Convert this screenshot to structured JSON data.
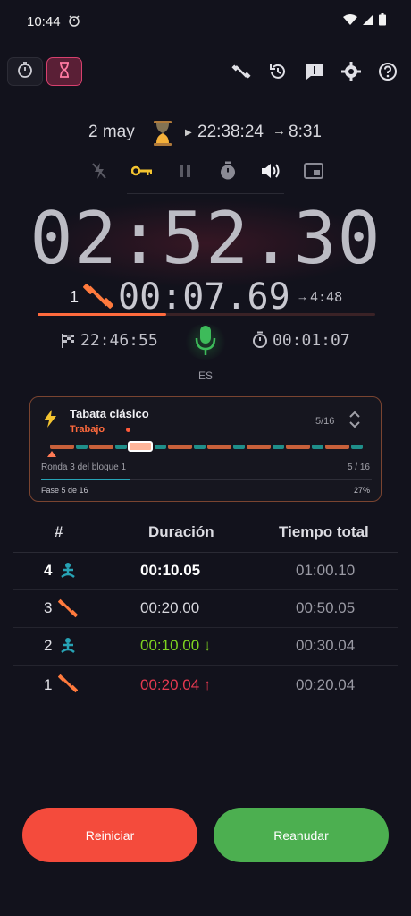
{
  "status_bar": {
    "time": "10:44"
  },
  "header": {
    "mode_stopwatch": "stopwatch-mode",
    "mode_timer": "timer-mode"
  },
  "info": {
    "date": "2 may",
    "start_time": "22:38:24",
    "end_time": "8:31"
  },
  "main_timer": "02:52.30",
  "lap": {
    "number": "1",
    "time": "00:07.69",
    "next": "4:48",
    "progress": 0.38
  },
  "meta": {
    "finish_time": "22:46:55",
    "language": "ES",
    "elapsed": "00:01:07"
  },
  "routine": {
    "title": "Tabata clásico",
    "phase": "Trabajo",
    "count": "5/16",
    "round_text": "Ronda 3 del bloque 1",
    "round_count": "5 / 16",
    "phase_text": "Fase 5 de 16",
    "phase_pct": "27%",
    "phase_progress": 0.27
  },
  "table": {
    "headers": {
      "num": "#",
      "duration": "Duración",
      "total": "Tiempo total"
    },
    "rows": [
      {
        "num": "4",
        "icon": "rest-icon",
        "duration": "00:10.05",
        "total": "01:00.10",
        "style": "current"
      },
      {
        "num": "3",
        "icon": "work-icon",
        "duration": "00:20.00",
        "total": "00:50.05",
        "style": "normal"
      },
      {
        "num": "2",
        "icon": "rest-icon",
        "duration": "00:10.00 ↓",
        "total": "00:30.04",
        "style": "faster"
      },
      {
        "num": "1",
        "icon": "work-icon",
        "duration": "00:20.04 ↑",
        "total": "00:20.04",
        "style": "slower"
      }
    ]
  },
  "buttons": {
    "reset": "Reiniciar",
    "resume": "Reanudar"
  },
  "colors": {
    "accent_work": "#ff6a3d",
    "accent_rest": "#27a3b5",
    "faster": "#7ed321",
    "slower": "#e53950",
    "reset": "#f44b3c",
    "resume": "#4caf50"
  }
}
